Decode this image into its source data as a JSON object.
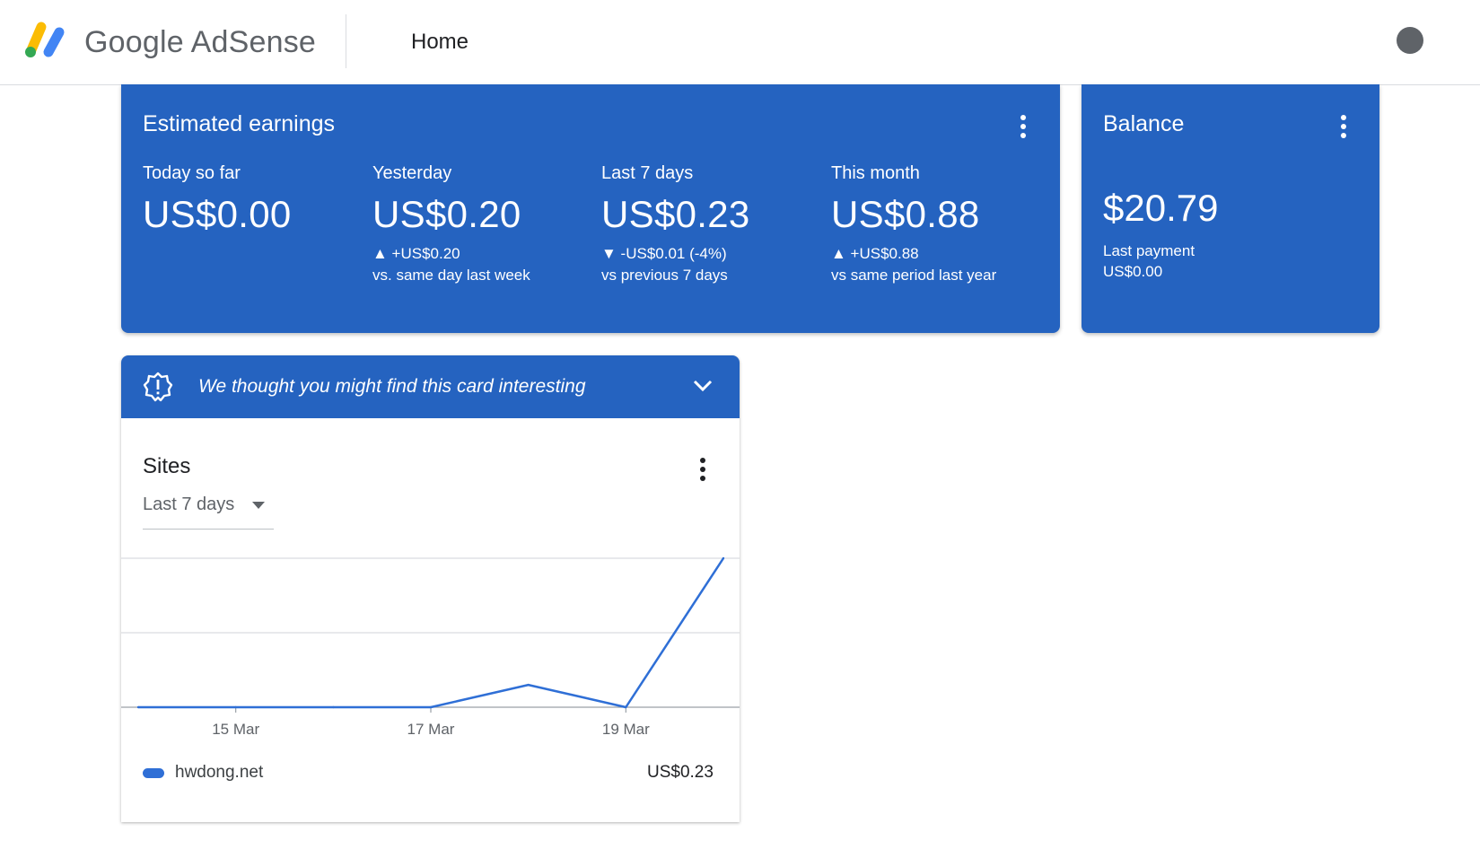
{
  "header": {
    "brand": "Google AdSense",
    "page_title": "Home",
    "help_icon": "help-icon"
  },
  "earnings": {
    "title": "Estimated earnings",
    "metrics": [
      {
        "label": "Today so far",
        "value": "US$0.00",
        "delta": "",
        "compare": ""
      },
      {
        "label": "Yesterday",
        "value": "US$0.20",
        "delta": "▲ +US$0.20",
        "compare": "vs. same day last week"
      },
      {
        "label": "Last 7 days",
        "value": "US$0.23",
        "delta": "▼ -US$0.01 (-4%)",
        "compare": "vs previous 7 days"
      },
      {
        "label": "This month",
        "value": "US$0.88",
        "delta": "▲ +US$0.88",
        "compare": "vs same period last year"
      }
    ]
  },
  "balance": {
    "title": "Balance",
    "value": "$20.79",
    "last_payment_label": "Last payment",
    "last_payment_value": "US$0.00"
  },
  "suggestion": {
    "text": "We thought you might find this card interesting"
  },
  "sites": {
    "title": "Sites",
    "range": "Last 7 days",
    "legend_name": "hwdong.net",
    "legend_value": "US$0.23"
  },
  "colors": {
    "accent": "#2563c0",
    "series": "#2f6fd6",
    "grid": "#dadce0"
  },
  "chart_data": {
    "type": "line",
    "x": [
      "14 Mar",
      "15 Mar",
      "16 Mar",
      "17 Mar",
      "18 Mar",
      "19 Mar",
      "20 Mar"
    ],
    "tick_labels": [
      "15 Mar",
      "17 Mar",
      "19 Mar"
    ],
    "series": [
      {
        "values": [
          0,
          0,
          0,
          0,
          0.03,
          0,
          0.2
        ]
      }
    ],
    "ylim": [
      0,
      0.2
    ],
    "grid": true,
    "title": "",
    "xlabel": "",
    "ylabel": ""
  }
}
